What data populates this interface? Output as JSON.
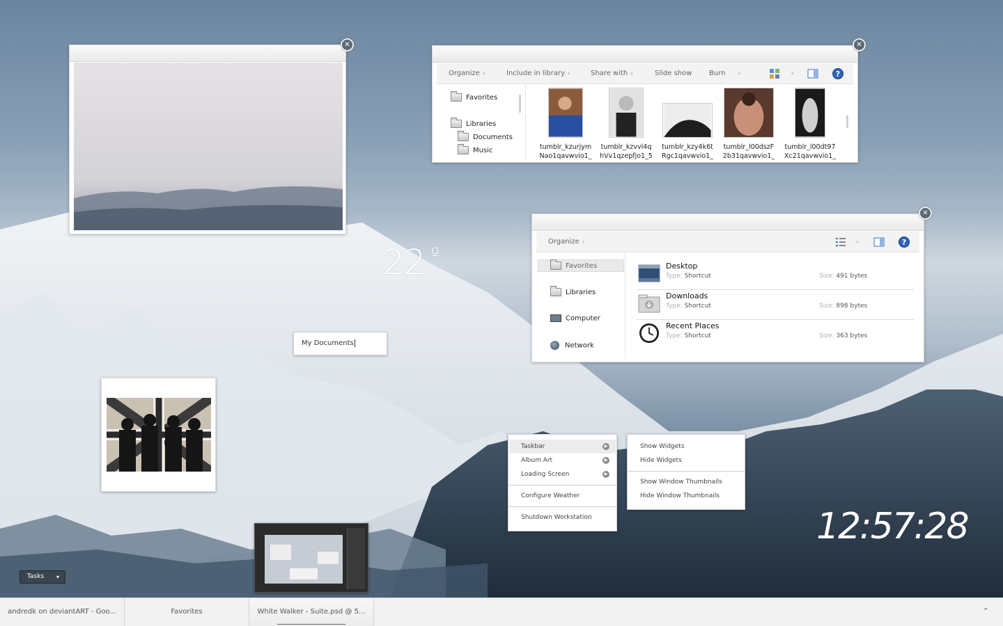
{
  "colors": {
    "accent": "#2f62b8",
    "close_button": "#5c6a74",
    "taskbar": "#f2f2f2"
  },
  "weather": {
    "temperature": "22",
    "degree_symbol": "º"
  },
  "clock": {
    "time": "12:57:28"
  },
  "rename_box": {
    "value": "My Documents"
  },
  "explorer_top": {
    "toolbar": [
      "Organize",
      "Include in library",
      "Share with",
      "Slide show",
      "Burn"
    ],
    "nav": {
      "favorites": "Favorites",
      "libraries": "Libraries",
      "documents": "Documents",
      "music": "Music"
    },
    "files": [
      {
        "line1": "tumblr_kzurjym",
        "line2": "Nao1qavwvio1_"
      },
      {
        "line1": "tumblr_kzvvl4q",
        "line2": "hVv1qzepfjo1_5"
      },
      {
        "line1": "tumblr_kzy4k6t",
        "line2": "Rgc1qavwvio1_"
      },
      {
        "line1": "tumblr_l00dszF",
        "line2": "2b31qavwvio1_"
      },
      {
        "line1": "tumblr_l00dt97",
        "line2": "Xc21qavwvio1_"
      }
    ],
    "icons": {
      "view": "view-thumbnails-icon",
      "preview": "preview-pane-icon",
      "help": "help-icon"
    }
  },
  "explorer_favorites": {
    "toolbar": {
      "organize": "Organize"
    },
    "nav": {
      "favorites": "Favorites",
      "libraries": "Libraries",
      "computer": "Computer",
      "network": "Network"
    },
    "items": [
      {
        "name": "Desktop",
        "type_label": "Type:",
        "type": "Shortcut",
        "size_label": "Size:",
        "size": "491 bytes",
        "icon": "desktop-icon"
      },
      {
        "name": "Downloads",
        "type_label": "Type:",
        "type": "Shortcut",
        "size_label": "Size:",
        "size": "898 bytes",
        "icon": "downloads-icon"
      },
      {
        "name": "Recent Places",
        "type_label": "Type:",
        "type": "Shortcut",
        "size_label": "Size:",
        "size": "363 bytes",
        "icon": "clock-icon"
      }
    ]
  },
  "context_menu": {
    "items": [
      "Taskbar",
      "Album Art",
      "Loading Screen",
      "Configure Weather",
      "Shutdown Workstation"
    ]
  },
  "submenu": {
    "items": [
      "Show Widgets",
      "Hide Widgets",
      "Show Window Thumbnails",
      "Hide Window Thumbnails"
    ]
  },
  "tasks_button": {
    "label": "Tasks",
    "arrow": "▾"
  },
  "taskbar": {
    "buttons": [
      "andredk on deviantART - Goo...",
      "Favorites",
      "White Walker - Suite.psd @ 5..."
    ],
    "tray_arrow": "⌃"
  }
}
